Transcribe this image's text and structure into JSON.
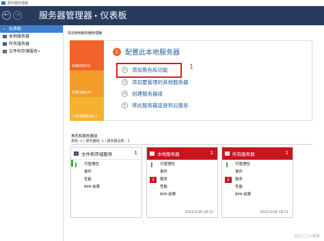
{
  "titlebar": {
    "title": "服务器管理器"
  },
  "header": {
    "breadcrumb_root": "服务器管理器",
    "breadcrumb_sep": "▸",
    "breadcrumb_page": "仪表板",
    "back_glyph": "←",
    "forward_glyph": "→"
  },
  "sidebar": {
    "items": [
      {
        "label": "仪表板",
        "icon": "dashboard-icon",
        "active": true
      },
      {
        "label": "本地服务器",
        "icon": "server-icon"
      },
      {
        "label": "所有服务器",
        "icon": "servers-icon"
      },
      {
        "label": "文件和存储服务",
        "icon": "storage-icon",
        "arrow": "▸"
      }
    ]
  },
  "welcome": {
    "title": "欢迎使用服务器管理器"
  },
  "quickstart": {
    "strips": [
      {
        "label": "快速启动(Q)",
        "color": "#f0632a"
      },
      {
        "label": "新增功能(W)",
        "color": "#f49c2a"
      },
      {
        "label": "了解详细信息(L)",
        "color": "#f4b22f"
      }
    ],
    "main_step": {
      "num": "1",
      "label": "配置此本地服务器"
    },
    "steps": [
      {
        "num": "2",
        "label": "添加角色和功能"
      },
      {
        "num": "3",
        "label": "添加要管理的其他服务器"
      },
      {
        "num": "4",
        "label": "创建服务器组"
      },
      {
        "num": "5",
        "label": "将此服务器连接到云服务"
      }
    ],
    "annotation": "1"
  },
  "groups": {
    "title": "角色和服务器组",
    "subtitle_prefix": "角色: 1 | 服务器组: 1 | 服务器总数:",
    "subtitle_count": "1",
    "cards": [
      {
        "name": "文件和存储服务",
        "count": "1",
        "alert": false,
        "rows": [
          {
            "label": "可管理性",
            "badge": ""
          },
          {
            "label": "事件",
            "badge": ""
          },
          {
            "label": "性能",
            "badge": ""
          },
          {
            "label": "BPA 结果",
            "badge": ""
          }
        ],
        "time": ""
      },
      {
        "name": "本地服务器",
        "count": "1",
        "alert": true,
        "rows": [
          {
            "label": "可管理性",
            "badge": ""
          },
          {
            "label": "事件",
            "badge": ""
          },
          {
            "label": "服务",
            "badge": "2"
          },
          {
            "label": "性能",
            "badge": ""
          },
          {
            "label": "BPA 结果",
            "badge": ""
          }
        ],
        "time": "2021/1/16 19:11"
      },
      {
        "name": "所有服务器",
        "count": "1",
        "alert": true,
        "rows": [
          {
            "label": "可管理性",
            "badge": ""
          },
          {
            "label": "事件",
            "badge": ""
          },
          {
            "label": "服务",
            "badge": "2"
          },
          {
            "label": "性能",
            "badge": ""
          },
          {
            "label": "BPA 结果",
            "badge": ""
          }
        ],
        "time": "2021/1/16 19:11"
      }
    ]
  },
  "watermark": "@51CTO博客",
  "colors": {
    "header": "#263b5e",
    "accent": "#3f82d1",
    "alert": "#c8151e",
    "ok": "#3aa935",
    "orange": "#f0632a"
  }
}
